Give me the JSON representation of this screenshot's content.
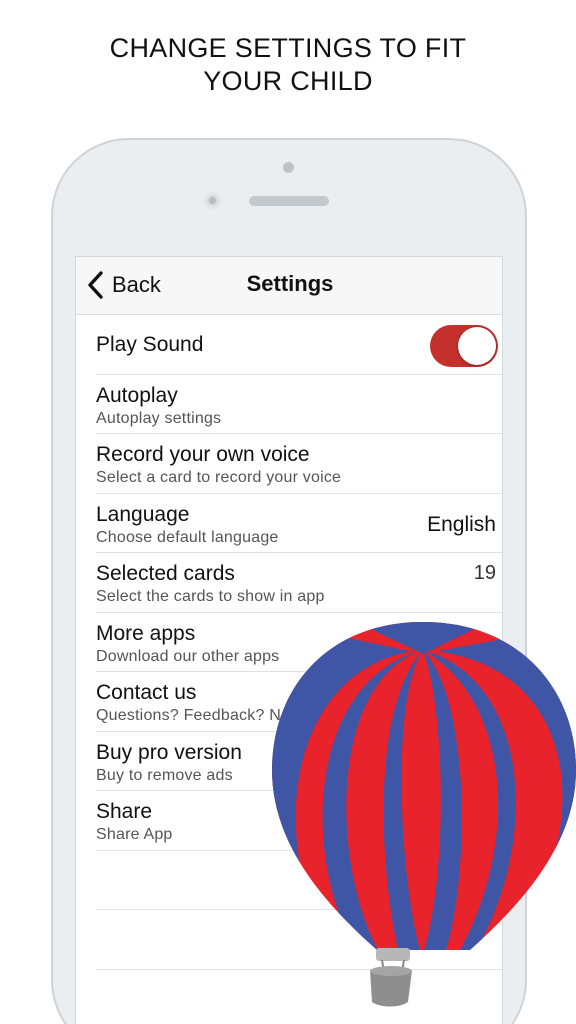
{
  "promo": {
    "headline_line1": "CHANGE SETTINGS TO FIT",
    "headline_line2": "YOUR CHILD"
  },
  "navbar": {
    "back_label": "Back",
    "back_icon": "chevron-left-icon",
    "title": "Settings"
  },
  "settings": {
    "play_sound": {
      "title": "Play Sound",
      "enabled": true
    },
    "autoplay": {
      "title": "Autoplay",
      "subtitle": "Autoplay settings"
    },
    "record_voice": {
      "title": "Record your own voice",
      "subtitle": "Select a card to record your voice"
    },
    "language": {
      "title": "Language",
      "subtitle": "Choose default language",
      "value": "English"
    },
    "selected_cards": {
      "title": "Selected cards",
      "subtitle": "Select the cards to show in app",
      "value": "19"
    },
    "more_apps": {
      "title": "More apps",
      "subtitle": "Download our other apps"
    },
    "contact": {
      "title": "Contact us",
      "subtitle": "Questions? Feedback? N"
    },
    "buy_pro": {
      "title": "Buy pro version",
      "subtitle": "Buy to remove ads"
    },
    "share": {
      "title": "Share",
      "subtitle": "Share App"
    }
  },
  "colors": {
    "toggle_on": "#c4302b",
    "balloon_red": "#e8232c",
    "balloon_blue": "#3f56a6",
    "basket": "#8e8e8e"
  },
  "decoration": {
    "balloon_icon": "hot-air-balloon-icon"
  }
}
